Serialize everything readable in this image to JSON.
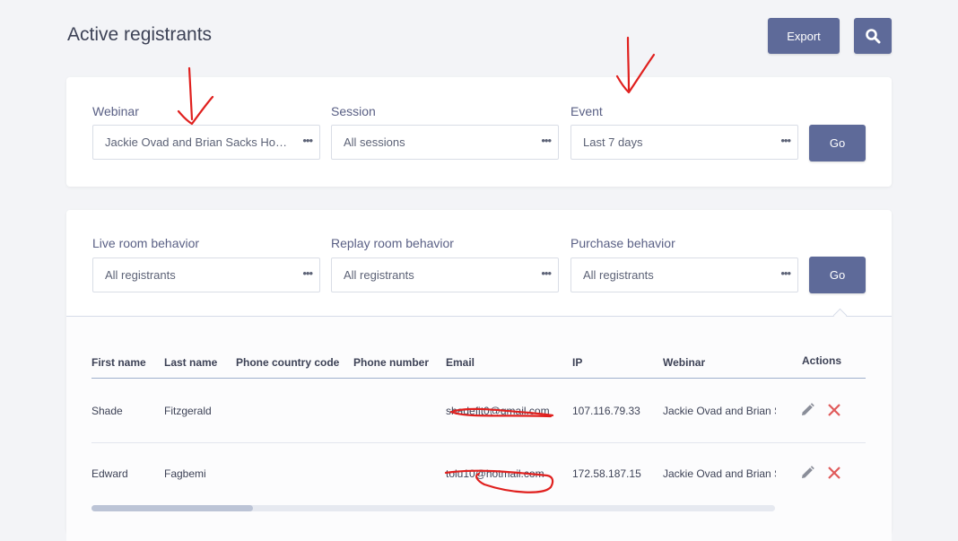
{
  "page": {
    "title": "Active registrants"
  },
  "toolbar": {
    "export_label": "Export",
    "search_icon": "search-icon"
  },
  "filters": {
    "webinar": {
      "label": "Webinar",
      "value": "Jackie Ovad and Brian Sacks Hom..."
    },
    "session": {
      "label": "Session",
      "value": "All sessions"
    },
    "event": {
      "label": "Event",
      "value": "Last 7 days"
    },
    "go_label": "Go",
    "more_glyph": "•••"
  },
  "behavior": {
    "live": {
      "label": "Live room behavior",
      "value": "All registrants"
    },
    "replay": {
      "label": "Replay room behavior",
      "value": "All registrants"
    },
    "purchase": {
      "label": "Purchase behavior",
      "value": "All registrants"
    },
    "go_label": "Go"
  },
  "table": {
    "headers": [
      "First name",
      "Last name",
      "Phone country code",
      "Phone number",
      "Email",
      "IP",
      "Webinar",
      "Actions"
    ],
    "rows": [
      {
        "first": "Shade",
        "last": "Fitzgerald",
        "country_code": "",
        "phone": "",
        "email": "shadefit0@gmail.com",
        "ip": "107.116.79.33",
        "webinar": "Jackie Ovad and Brian S"
      },
      {
        "first": "Edward",
        "last": "Fagbemi",
        "country_code": "",
        "phone": "",
        "email": "tolu10@hotmail.com",
        "ip": "172.58.187.15",
        "webinar": "Jackie Ovad and Brian S"
      }
    ]
  },
  "colors": {
    "accent": "#5e6a99",
    "delete": "#e05a5a",
    "edit": "#8a8e99",
    "annotation": "#e0201e"
  }
}
